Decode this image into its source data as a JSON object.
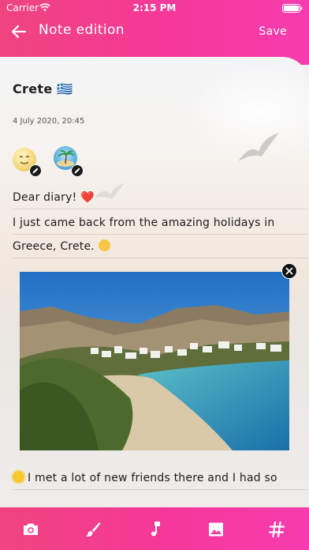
{
  "status_bar": {
    "carrier": "Carrier",
    "time": "2:15 PM"
  },
  "nav": {
    "title": "Note edition",
    "save_label": "Save"
  },
  "note": {
    "title": "Crete 🇬🇷",
    "date": "4 July 2020, 20:45",
    "lines": [
      "Dear diary! ",
      "I just came back from the amazing holidays in",
      "Greece, Crete. ",
      "I met a lot of new friends there and I had so"
    ],
    "line1_emoji": "❤️"
  },
  "toolbar": {
    "items": [
      "camera-icon",
      "brush-icon",
      "music-note-icon",
      "image-icon",
      "hashtag-icon"
    ]
  },
  "colors": {
    "accent_start": "#f0447e",
    "accent_end": "#f63cae"
  }
}
